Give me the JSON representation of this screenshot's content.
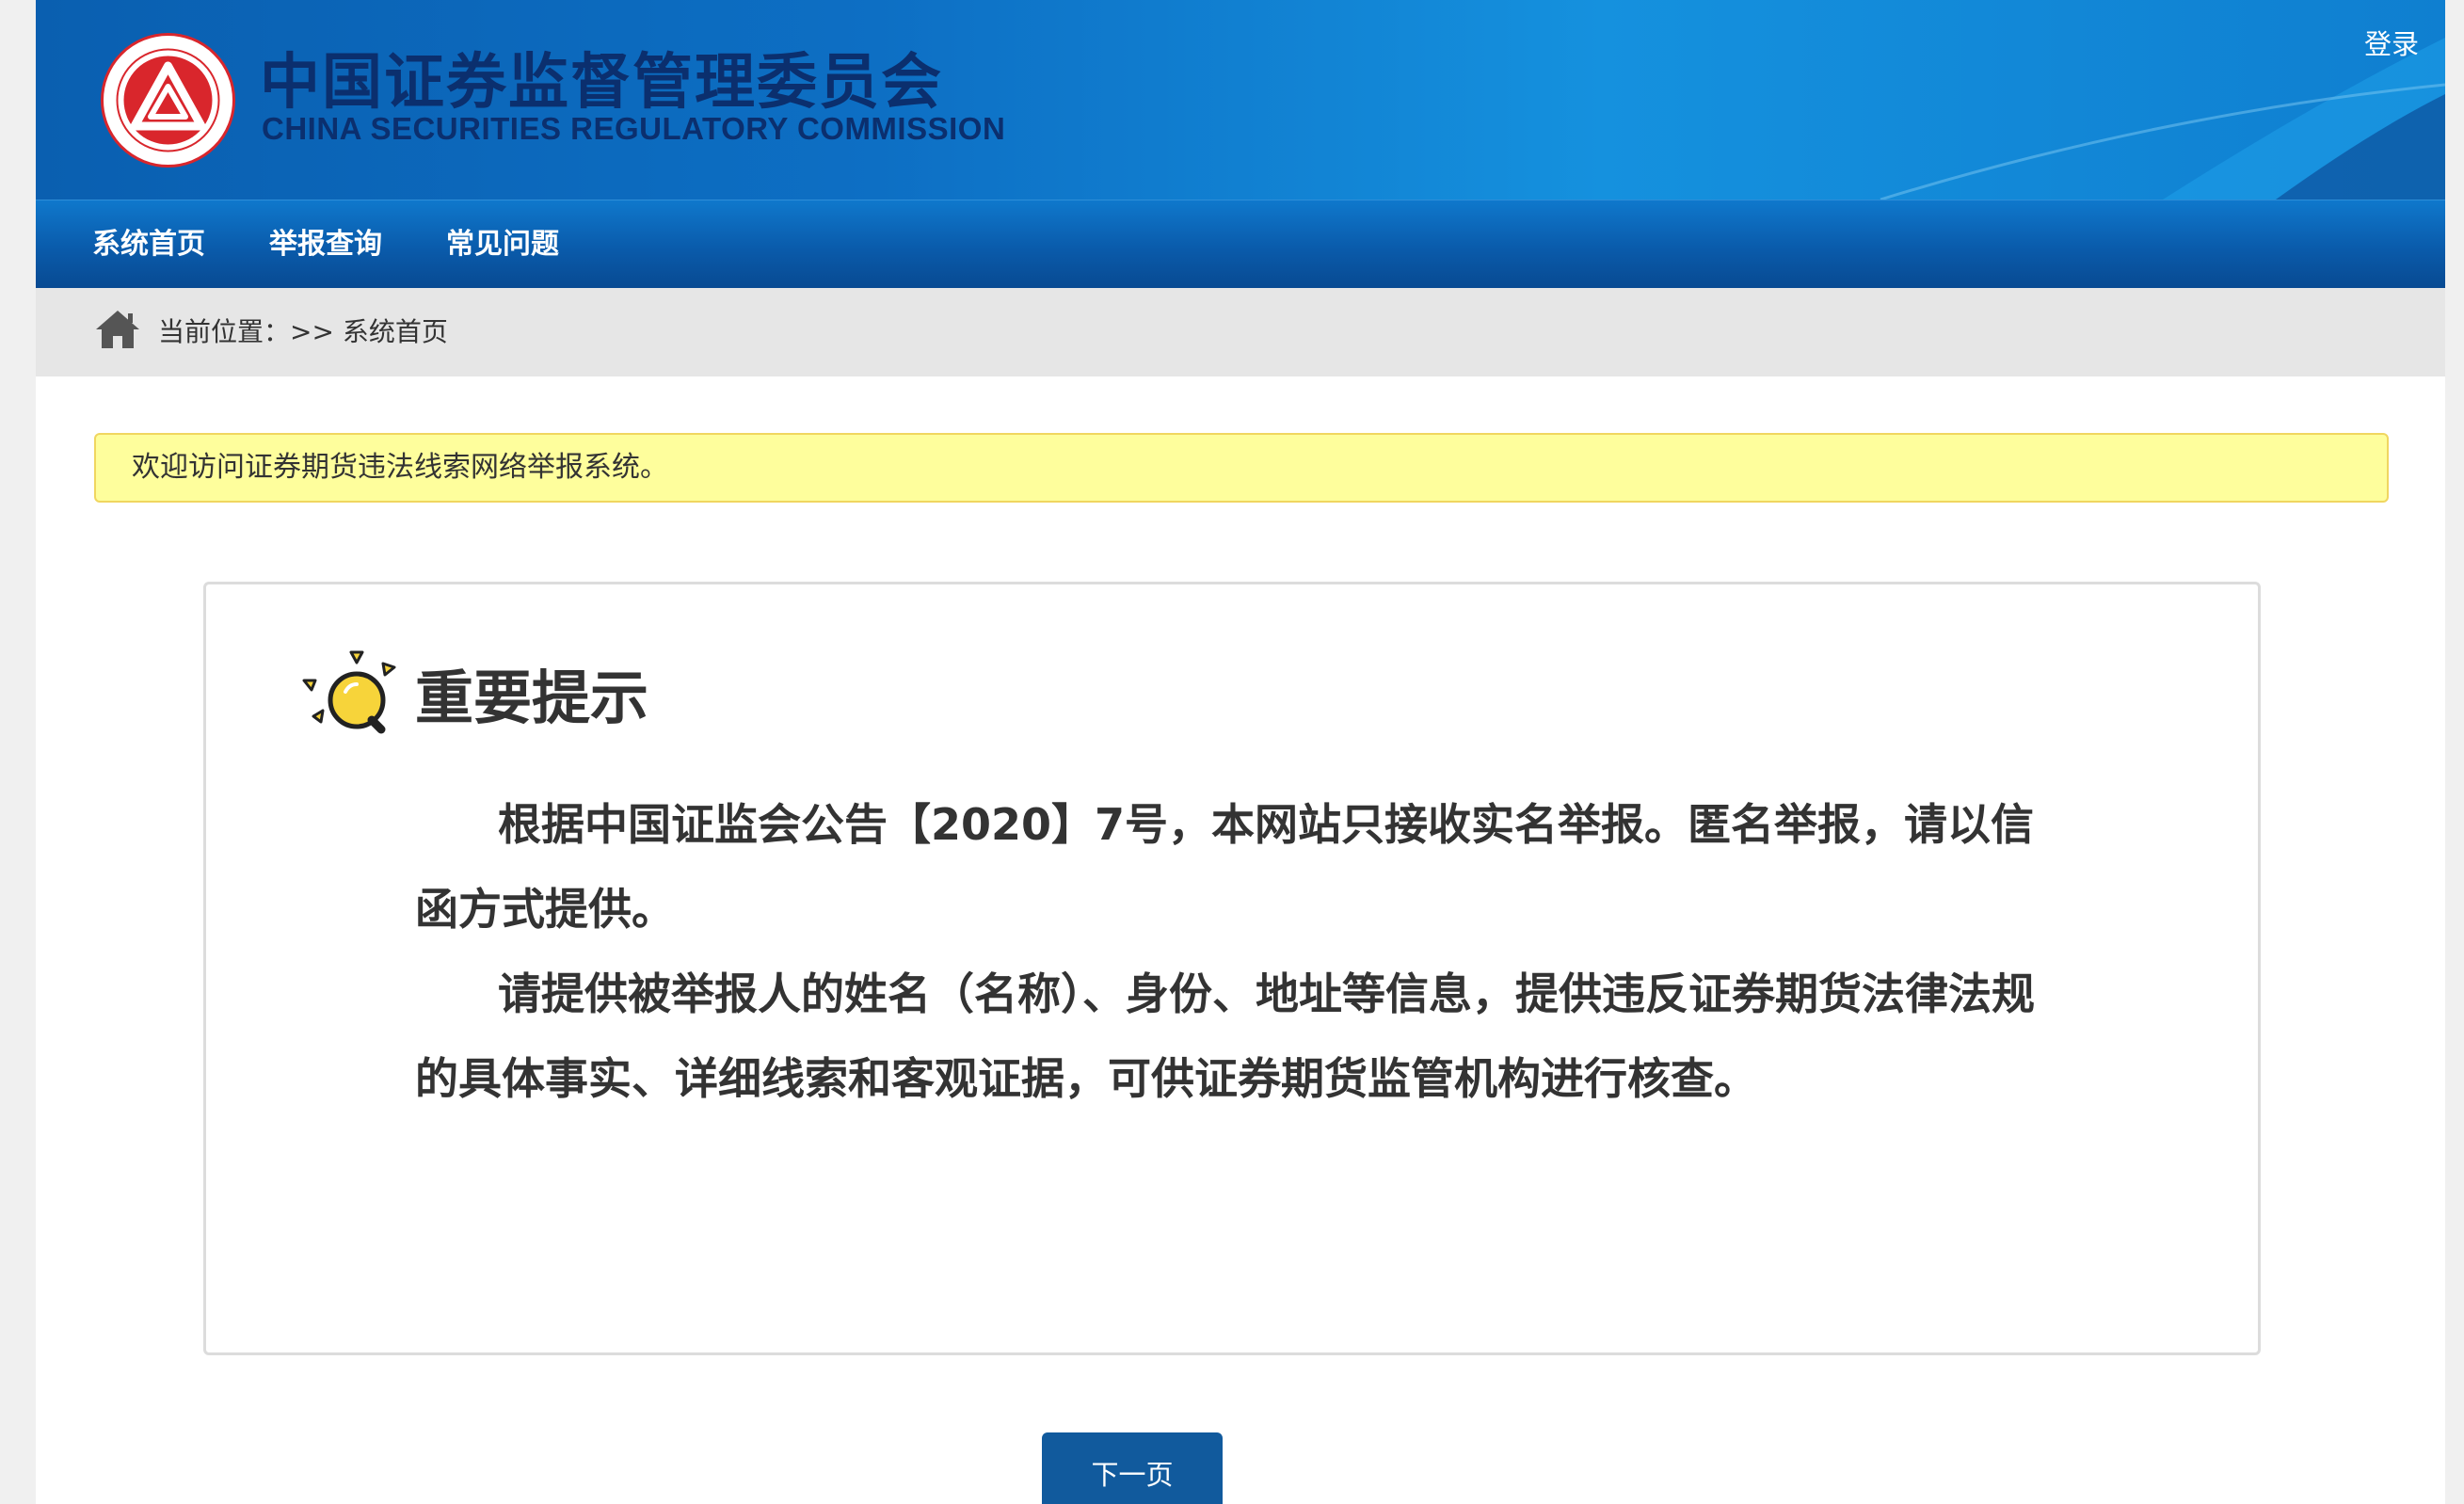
{
  "header": {
    "logo_cn": "中国证券监督管理委员会",
    "logo_en": "CHINA SECURITIES REGULATORY COMMISSION",
    "login_label": "登录"
  },
  "nav": {
    "items": [
      {
        "label": "系统首页"
      },
      {
        "label": "举报查询"
      },
      {
        "label": "常见问题"
      }
    ]
  },
  "breadcrumb": {
    "text": "当前位置：>> 系统首页"
  },
  "notice": {
    "text": "欢迎访问证券期货违法线索网络举报系统。"
  },
  "card": {
    "title": "重要提示",
    "paragraphs": [
      "根据中国证监会公告【2020】7号，本网站只接收实名举报。匿名举报，请以信函方式提供。",
      "请提供被举报人的姓名（名称）、身份、地址等信息，提供违反证券期货法律法规的具体事实、详细线索和客观证据，可供证券期货监管机构进行核查。"
    ]
  },
  "footer": {
    "next_label": "下一页"
  },
  "colors": {
    "header_blue": "#0d6fc4",
    "nav_blue": "#0a5bab",
    "logo_red": "#d9262c",
    "notice_yellow": "#fefe9c",
    "button_blue": "#115a9d"
  },
  "icons": {
    "home": "home-icon",
    "bulb": "lightbulb-icon"
  }
}
